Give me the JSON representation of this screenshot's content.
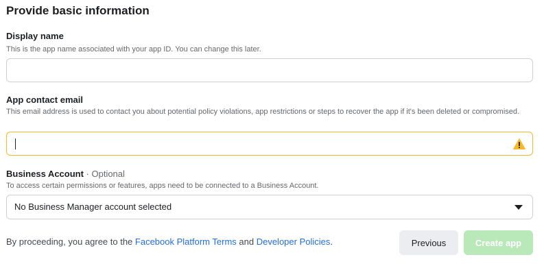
{
  "page": {
    "title": "Provide basic information"
  },
  "display_name": {
    "label": "Display name",
    "help": "This is the app name associated with your app ID. You can change this later.",
    "value": ""
  },
  "contact_email": {
    "label": "App contact email",
    "help": "This email address is used to contact you about potential policy violations, app restrictions or steps to recover the app if it's been deleted or compromised.",
    "value": "",
    "status_icon": "warning-icon",
    "warning_color": "#f7b928"
  },
  "business_account": {
    "label": "Business Account",
    "optional": " · Optional",
    "help": "To access certain permissions or features, apps need to be connected to a Business Account.",
    "selected": "No Business Manager account selected"
  },
  "footer": {
    "prefix": "By proceeding, you agree to the ",
    "terms_link": "Facebook Platform Terms",
    "and": " and ",
    "policies_link": "Developer Policies",
    "suffix": "."
  },
  "buttons": {
    "previous": "Previous",
    "create": "Create app"
  },
  "colors": {
    "link": "#216fdb",
    "create_disabled": "#b9e8b9"
  }
}
